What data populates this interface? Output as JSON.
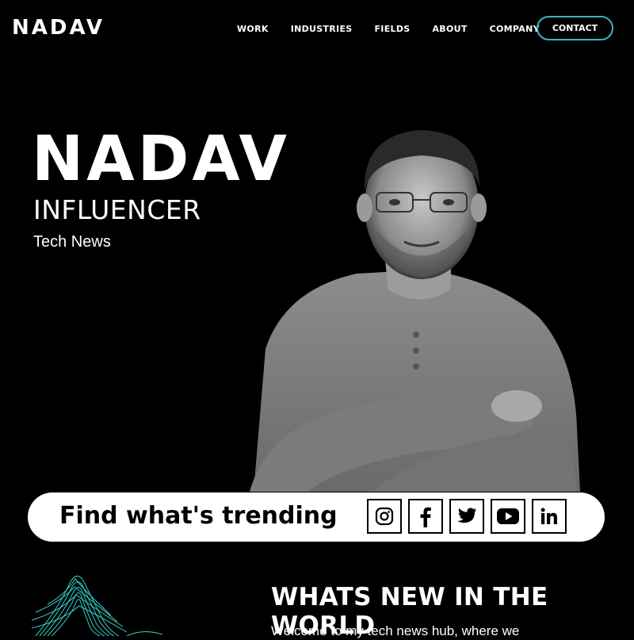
{
  "header": {
    "logo": "NADAV",
    "nav": [
      "WORK",
      "INDUSTRIES",
      "FIELDS",
      "ABOUT",
      "COMPANY"
    ],
    "contact_label": "CONTACT",
    "accent_color": "#36b6c3"
  },
  "hero": {
    "name": "NADAV",
    "role": "INFLUENCER",
    "subtitle": "Tech News"
  },
  "trending_bar": {
    "text": "Find what's trending",
    "socials": [
      "instagram-icon",
      "facebook-icon",
      "twitter-icon",
      "youtube-icon",
      "linkedin-icon"
    ]
  },
  "news": {
    "title": "WHATS NEW IN THE WORLD",
    "body": "Welcome to my tech news hub, where we"
  }
}
